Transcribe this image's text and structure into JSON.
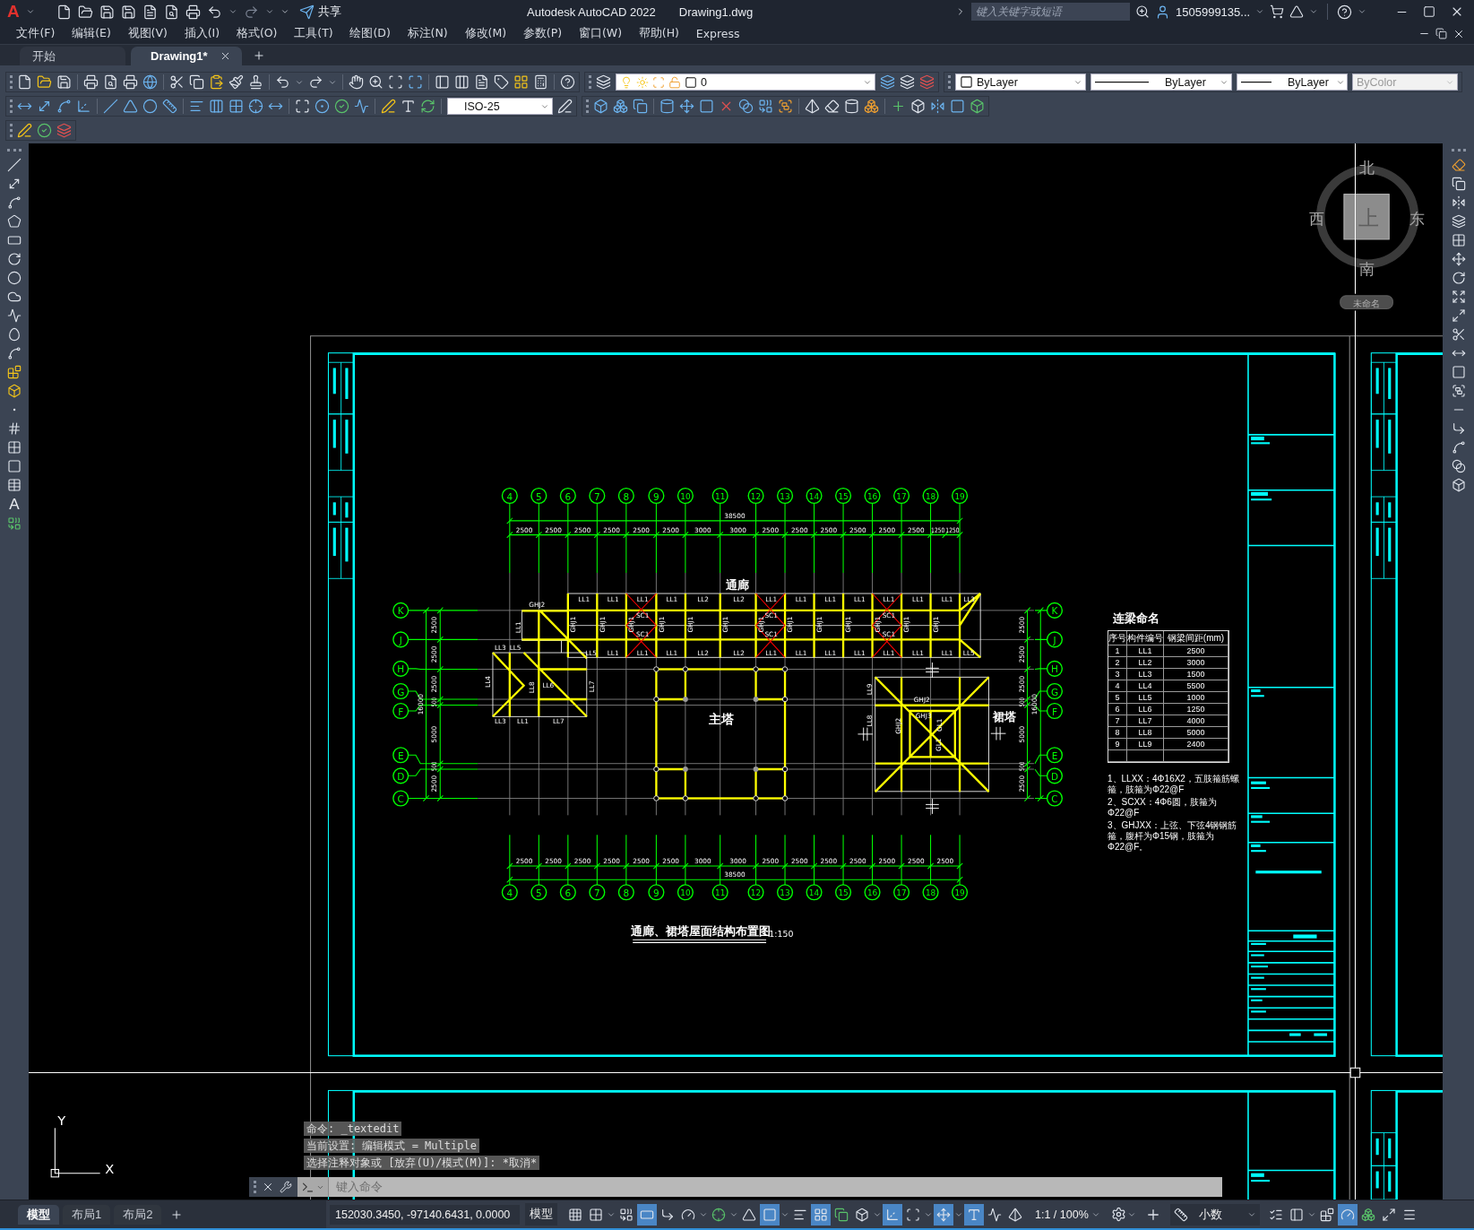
{
  "title_bar": {
    "logo": "A",
    "share": "共享",
    "app": "Autodesk AutoCAD 2022",
    "file": "Drawing1.dwg",
    "search": {
      "placeholder": "键入关键字或短语"
    },
    "user": "1505999135..."
  },
  "menu": [
    "文件(F)",
    "编辑(E)",
    "视图(V)",
    "插入(I)",
    "格式(O)",
    "工具(T)",
    "绘图(D)",
    "标注(N)",
    "修改(M)",
    "参数(P)",
    "窗口(W)",
    "帮助(H)",
    "Express"
  ],
  "file_tabs": [
    {
      "label": "开始",
      "selected": false
    },
    {
      "label": "Drawing1*",
      "selected": true
    }
  ],
  "properties": {
    "layer": "0",
    "dropdowns": [
      {
        "kind": "swatch",
        "value": "ByLayer",
        "disabled": false
      },
      {
        "kind": "long_line",
        "value": "ByLayer",
        "disabled": false
      },
      {
        "kind": "short_line",
        "value": "ByLayer",
        "disabled": false
      },
      {
        "kind": "plain",
        "value": "ByColor",
        "disabled": true
      }
    ]
  },
  "dimension_style": "ISO-25",
  "draw_toolbar": {
    "text_tool": "A"
  },
  "drawing": {
    "top_axes": [
      "4",
      "5",
      "6",
      "7",
      "8",
      "9",
      "10",
      "11",
      "12",
      "13",
      "14",
      "15",
      "16",
      "17",
      "18",
      "19"
    ],
    "bottom_axes": [
      "4",
      "5",
      "6",
      "7",
      "8",
      "9",
      "10",
      "11",
      "12",
      "13",
      "14",
      "15",
      "16",
      "17",
      "18",
      "19"
    ],
    "left_axes": [
      "K",
      "J",
      "H",
      "G",
      "F",
      "E",
      "D",
      "C"
    ],
    "right_axes": [
      "K",
      "J",
      "H",
      "G",
      "F",
      "E",
      "D",
      "C"
    ],
    "top_total": "38500",
    "top_spans": [
      "2500",
      "2500",
      "2500",
      "2500",
      "2500",
      "2500",
      "3000",
      "3000",
      "2500",
      "2500",
      "2500",
      "2500",
      "2500",
      "2500",
      "1250",
      "1250"
    ],
    "bottom_spans": [
      "2500",
      "2500",
      "2500",
      "2500",
      "2500",
      "2500",
      "3000",
      "3000",
      "2500",
      "2500",
      "2500",
      "2500",
      "2500",
      "2500",
      "2500"
    ],
    "bottom_total": "38500",
    "left_spans": [
      "2500",
      "2500",
      "2500",
      "500",
      "5000",
      "500",
      "2500"
    ],
    "left_total": "16000",
    "right_spans": [
      "2500",
      "2500",
      "2500",
      "500",
      "5000",
      "500",
      "2500"
    ],
    "right_total": "16000",
    "area_labels": [
      "通廊",
      "主塔",
      "裙塔"
    ],
    "corridor_top_beams": [
      "LL1",
      "LL1",
      "LL1",
      "LL1",
      "LL2",
      "LL2",
      "LL1",
      "LL1",
      "LL1",
      "LL1",
      "LL1",
      "LL1",
      "LL1",
      "LL3"
    ],
    "corridor_bottom_beams": [
      "LL5",
      "LL1",
      "LL1",
      "LL1",
      "LL2",
      "LL2",
      "LL1",
      "LL1",
      "LL1",
      "LL1",
      "LL1",
      "LL1",
      "LL1",
      "LL5"
    ],
    "brace_labels": [
      "SC1",
      "SC1",
      "SC1",
      "SC1",
      "SC1",
      "SC1"
    ],
    "truss_labels": [
      "GHJ1",
      "GHJ1",
      "GHJ1",
      "GHJ1",
      "GHJ1",
      "GHJ1",
      "GHJ1",
      "GHJ1",
      "GHJ1",
      "GHJ1",
      "GHJ1",
      "GHJ1",
      "GHJ1"
    ],
    "wing_labels": [
      "GHJ2",
      "LL1",
      "LL3",
      "LL5",
      "LL4",
      "LL3",
      "LL1",
      "LL7",
      "LL7",
      "LL6",
      "LL8"
    ],
    "tower_labels": [
      "LL9",
      "LL8",
      "GHJ2",
      "GHJ3",
      "GHJ2",
      "GL1",
      "GL1"
    ],
    "title": "通廊、裙塔屋面结构布置图",
    "scale": "1:150"
  },
  "schedule": {
    "title": "连梁命名",
    "columns": [
      "序号",
      "构件编号",
      "钢梁间距(mm)"
    ],
    "rows": [
      [
        "1",
        "LL1",
        "2500"
      ],
      [
        "2",
        "LL2",
        "3000"
      ],
      [
        "3",
        "LL3",
        "1500"
      ],
      [
        "4",
        "LL4",
        "5500"
      ],
      [
        "5",
        "LL5",
        "1000"
      ],
      [
        "6",
        "LL6",
        "1250"
      ],
      [
        "7",
        "LL7",
        "4000"
      ],
      [
        "8",
        "LL8",
        "5000"
      ],
      [
        "9",
        "LL9",
        "2400"
      ]
    ],
    "notes": [
      "1、LLXX：4Φ16X2，五肢箍筋螺箍，肢箍为Φ22@F",
      "2、SCXX：4Φ6圆，肢箍为Φ22@F",
      "3、GHJXX：上弦、下弦4钢钢筋箍，腹杆为Φ15钢，肢箍为Φ22@F。"
    ]
  },
  "view_cube": {
    "north": "北",
    "east": "东",
    "south": "南",
    "west": "西",
    "face": "上",
    "coordinate_system": "未命名"
  },
  "ucs_icon": {
    "x": "X",
    "y": "Y"
  },
  "command_history": [
    "命令: _textedit",
    "当前设置: 编辑模式 = Multiple",
    "选择注释对象或 [放弃(U)/模式(M)]: *取消*"
  ],
  "command_line": {
    "placeholder": "键入命令"
  },
  "layout_tabs": [
    {
      "label": "模型",
      "selected": true
    },
    {
      "label": "布局1",
      "selected": false
    },
    {
      "label": "布局2",
      "selected": false
    }
  ],
  "status_bar": {
    "coordinates": "152030.3450, -97140.6431, 0.0000",
    "space": "模型",
    "toggles": [
      {
        "kind": "grid",
        "on": false,
        "dropdown": false
      },
      {
        "kind": "snap",
        "on": false,
        "dropdown": true
      },
      {
        "kind": "infer",
        "on": false,
        "dropdown": false
      },
      {
        "kind": "dynamic_input",
        "on": true,
        "dropdown": false
      },
      {
        "kind": "ortho",
        "on": false,
        "dropdown": false
      },
      {
        "kind": "polar",
        "on": false,
        "dropdown": true
      },
      {
        "kind": "osnap_track",
        "on": false,
        "dropdown": true
      },
      {
        "kind": "angle",
        "on": false,
        "dropdown": false
      },
      {
        "kind": "osnap",
        "on": true,
        "dropdown": true
      },
      {
        "kind": "lineweight",
        "on": false,
        "dropdown": false
      },
      {
        "kind": "transparency",
        "on": true,
        "dropdown": false
      },
      {
        "kind": "cycling",
        "on": false,
        "dropdown": false
      },
      {
        "kind": "osnap3d",
        "on": false,
        "dropdown": true
      },
      {
        "kind": "ucs",
        "on": true,
        "dropdown": false
      },
      {
        "kind": "filter",
        "on": false,
        "dropdown": true
      },
      {
        "kind": "gizmo",
        "on": true,
        "dropdown": true
      },
      {
        "kind": "annotation",
        "on": true,
        "dropdown": false
      },
      {
        "kind": "autoscale",
        "on": false,
        "dropdown": false
      },
      {
        "kind": "annoscale",
        "on": false,
        "dropdown": false
      }
    ],
    "annotation_scale": "1:1 / 100%",
    "units": "小数",
    "toggles_right": [
      {
        "kind": "properties",
        "on": false,
        "dropdown": false
      },
      {
        "kind": "lock",
        "on": false,
        "dropdown": true
      },
      {
        "kind": "isolate",
        "on": false,
        "dropdown": false
      },
      {
        "kind": "performance",
        "on": true,
        "dropdown": false
      },
      {
        "kind": "clean",
        "on": false,
        "dropdown": false
      },
      {
        "kind": "fullscreen",
        "on": false,
        "dropdown": false
      },
      {
        "kind": "customize",
        "on": false,
        "dropdown": false
      }
    ]
  }
}
